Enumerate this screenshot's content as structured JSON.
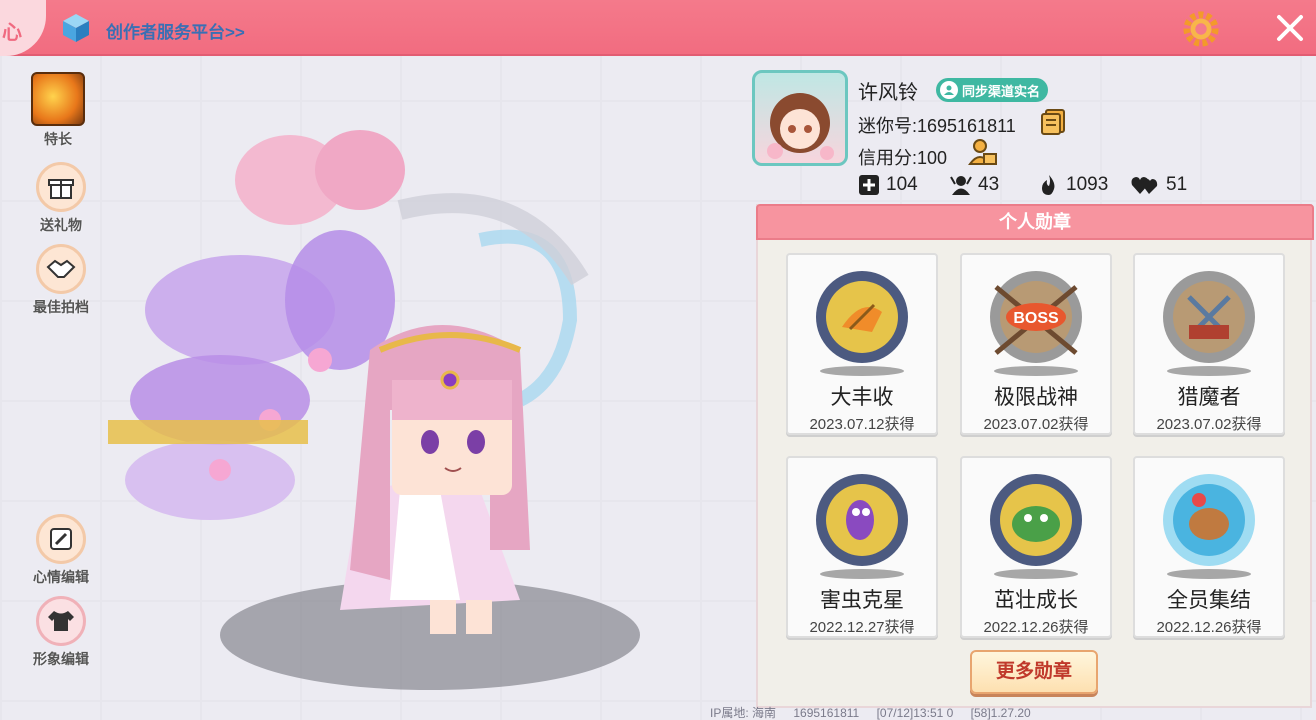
{
  "topbar": {
    "corner_text": "心",
    "platform_link": "创作者服务平台>>"
  },
  "sidebar": {
    "items": [
      {
        "label": "特长",
        "icon": "talent-icon"
      },
      {
        "label": "送礼物",
        "icon": "gift-icon"
      },
      {
        "label": "最佳拍档",
        "icon": "handshake-icon"
      },
      {
        "label": "心情编辑",
        "icon": "edit-icon"
      },
      {
        "label": "形象编辑",
        "icon": "outfit-icon"
      }
    ]
  },
  "profile": {
    "name": "许风铃",
    "realname_badge": "同步渠道实名",
    "uid_line": "迷你号:1695161811",
    "credit_line": "信用分:100",
    "stats": {
      "likes": "104",
      "fans": "43",
      "popularity": "1093",
      "hearts": "51"
    }
  },
  "medals": {
    "header": "个人勋章",
    "items": [
      {
        "name": "大丰收",
        "date": "2023.07.12获得",
        "color": "#d8b84a"
      },
      {
        "name": "极限战神",
        "date": "2023.07.02获得",
        "color": "#b5b5b5"
      },
      {
        "name": "猎魔者",
        "date": "2023.07.02获得",
        "color": "#b5b5b5"
      },
      {
        "name": "害虫克星",
        "date": "2022.12.27获得",
        "color": "#d8b84a"
      },
      {
        "name": "茁壮成长",
        "date": "2022.12.26获得",
        "color": "#d8b84a"
      },
      {
        "name": "全员集结",
        "date": "2022.12.26获得",
        "color": "#6fc9e8"
      }
    ],
    "more_label": "更多勋章"
  },
  "footer": {
    "ip": "IP属地: 海南",
    "uid": "1695161811",
    "time": "[07/12]13:51 0",
    "version": "[58]1.27.20"
  }
}
